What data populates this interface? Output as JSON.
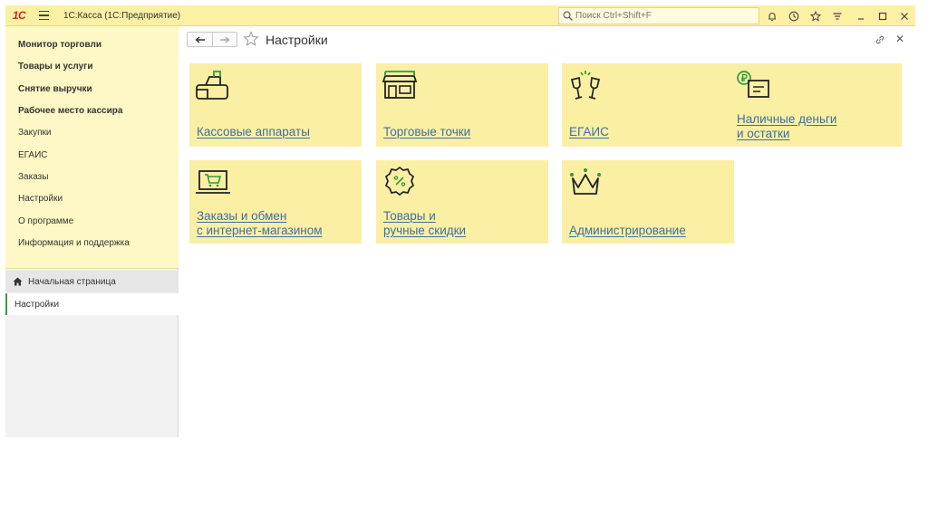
{
  "titlebar": {
    "logo": "1С",
    "app_title": "1С:Касса  (1С:Предприятие)",
    "search_placeholder": "Поиск Ctrl+Shift+F"
  },
  "sidebar": {
    "sections": [
      {
        "label": "Монитор торговли",
        "bold": true
      },
      {
        "label": "Товары и услуги",
        "bold": true
      },
      {
        "label": "Снятие выручки",
        "bold": true
      },
      {
        "label": "Рабочее место кассира",
        "bold": true
      },
      {
        "label": "Закупки",
        "bold": false
      },
      {
        "label": "ЕГАИС",
        "bold": false
      },
      {
        "label": "Заказы",
        "bold": false
      },
      {
        "label": "Настройки",
        "bold": false
      },
      {
        "label": "О программе",
        "bold": false
      },
      {
        "label": "Информация и поддержка",
        "bold": false
      }
    ],
    "history": {
      "home": "Начальная страница",
      "current": "Настройки"
    }
  },
  "content": {
    "title": "Настройки",
    "tiles": [
      {
        "line1": "Кассовые аппараты",
        "line2": "",
        "icon": "cash-register-icon"
      },
      {
        "line1": "Торговые точки",
        "line2": "",
        "icon": "store-icon"
      },
      {
        "line1": "ЕГАИС",
        "line2": "",
        "icon": "wine-glasses-icon"
      },
      {
        "line1": "Наличные деньги",
        "line2": "и остатки",
        "icon": "ruble-box-icon"
      },
      {
        "line1": "Заказы и обмен",
        "line2": "с интернет-магазином",
        "icon": "laptop-cart-icon"
      },
      {
        "line1": "Товары и",
        "line2": "ручные скидки",
        "icon": "discount-badge-icon"
      },
      {
        "line1": "Администрирование",
        "line2": "",
        "icon": "crown-icon"
      }
    ]
  },
  "colors": {
    "accent_green": "#2a9d3c",
    "tile_bg": "#fbefa4",
    "link_blue": "#3b6fa5",
    "logo_red": "#d0262a"
  }
}
